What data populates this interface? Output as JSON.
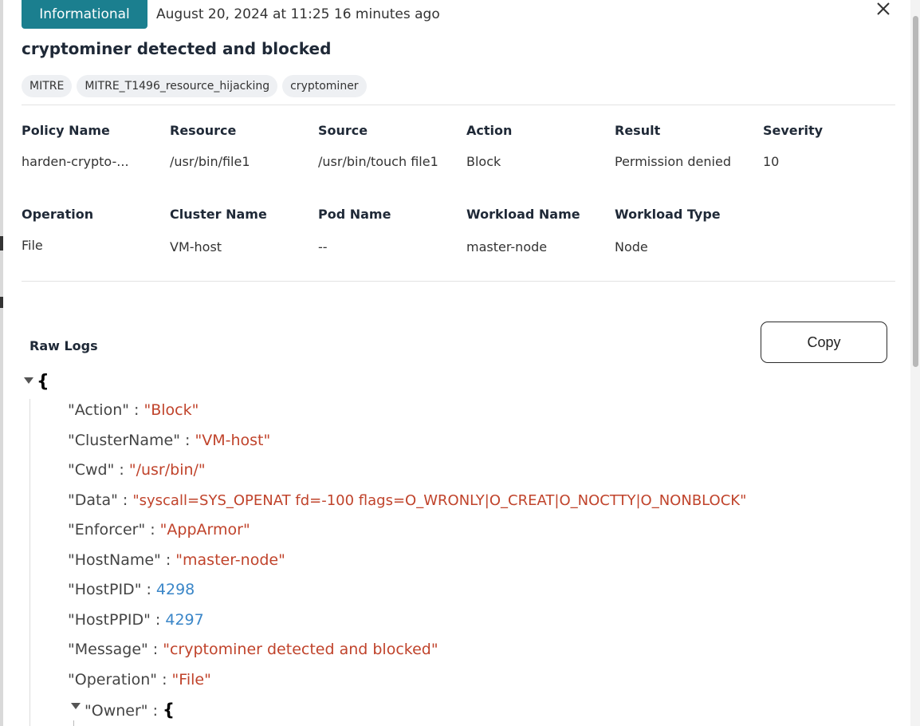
{
  "header": {
    "severity_badge": "Informational",
    "timestamp": "August 20, 2024 at 11:25 16 minutes ago",
    "title": "cryptominer detected and blocked"
  },
  "tags": [
    "MITRE",
    "MITRE_T1496_resource_hijacking",
    "cryptominer"
  ],
  "details": {
    "row1": [
      {
        "label": "Policy Name",
        "value": "harden-crypto-..."
      },
      {
        "label": "Resource",
        "value": "/usr/bin/file1"
      },
      {
        "label": "Source",
        "value": "/usr/bin/touch file1"
      },
      {
        "label": "Action",
        "value": "Block"
      },
      {
        "label": "Result",
        "value": "Permission denied"
      },
      {
        "label": "Severity",
        "value": "10"
      }
    ],
    "row2": [
      {
        "label": "Operation",
        "value": "File"
      },
      {
        "label": "Cluster Name",
        "value": "VM-host"
      },
      {
        "label": "Pod Name",
        "value": "--"
      },
      {
        "label": "Workload Name",
        "value": "master-node"
      },
      {
        "label": "Workload Type",
        "value": "Node"
      }
    ]
  },
  "raw_logs": {
    "title": "Raw Logs",
    "copy_label": "Copy",
    "open_brace": "{",
    "separator": " : ",
    "entries": [
      {
        "key": "\"Action\"",
        "value": "\"Block\""
      },
      {
        "key": "\"ClusterName\"",
        "value": "\"VM-host\""
      },
      {
        "key": "\"Cwd\"",
        "value": "\"/usr/bin/\""
      },
      {
        "key": "\"Data\"",
        "value": "\"syscall=SYS_OPENAT fd=-100 flags=O_WRONLY|O_CREAT|O_NOCTTY|O_NONBLOCK\""
      },
      {
        "key": "\"Enforcer\"",
        "value": "\"AppArmor\""
      },
      {
        "key": "\"HostName\"",
        "value": "\"master-node\""
      },
      {
        "key": "\"HostPID\"",
        "value": "4298"
      },
      {
        "key": "\"HostPPID\"",
        "value": "4297"
      },
      {
        "key": "\"Message\"",
        "value": "\"cryptominer detected and blocked\""
      },
      {
        "key": "\"Operation\"",
        "value": "\"File\""
      },
      {
        "key": "\"Owner\"",
        "value": "{"
      }
    ]
  },
  "colors": {
    "badge": "#1b7f8f",
    "json_string": "#c0432b",
    "json_number": "#3a86c8"
  }
}
